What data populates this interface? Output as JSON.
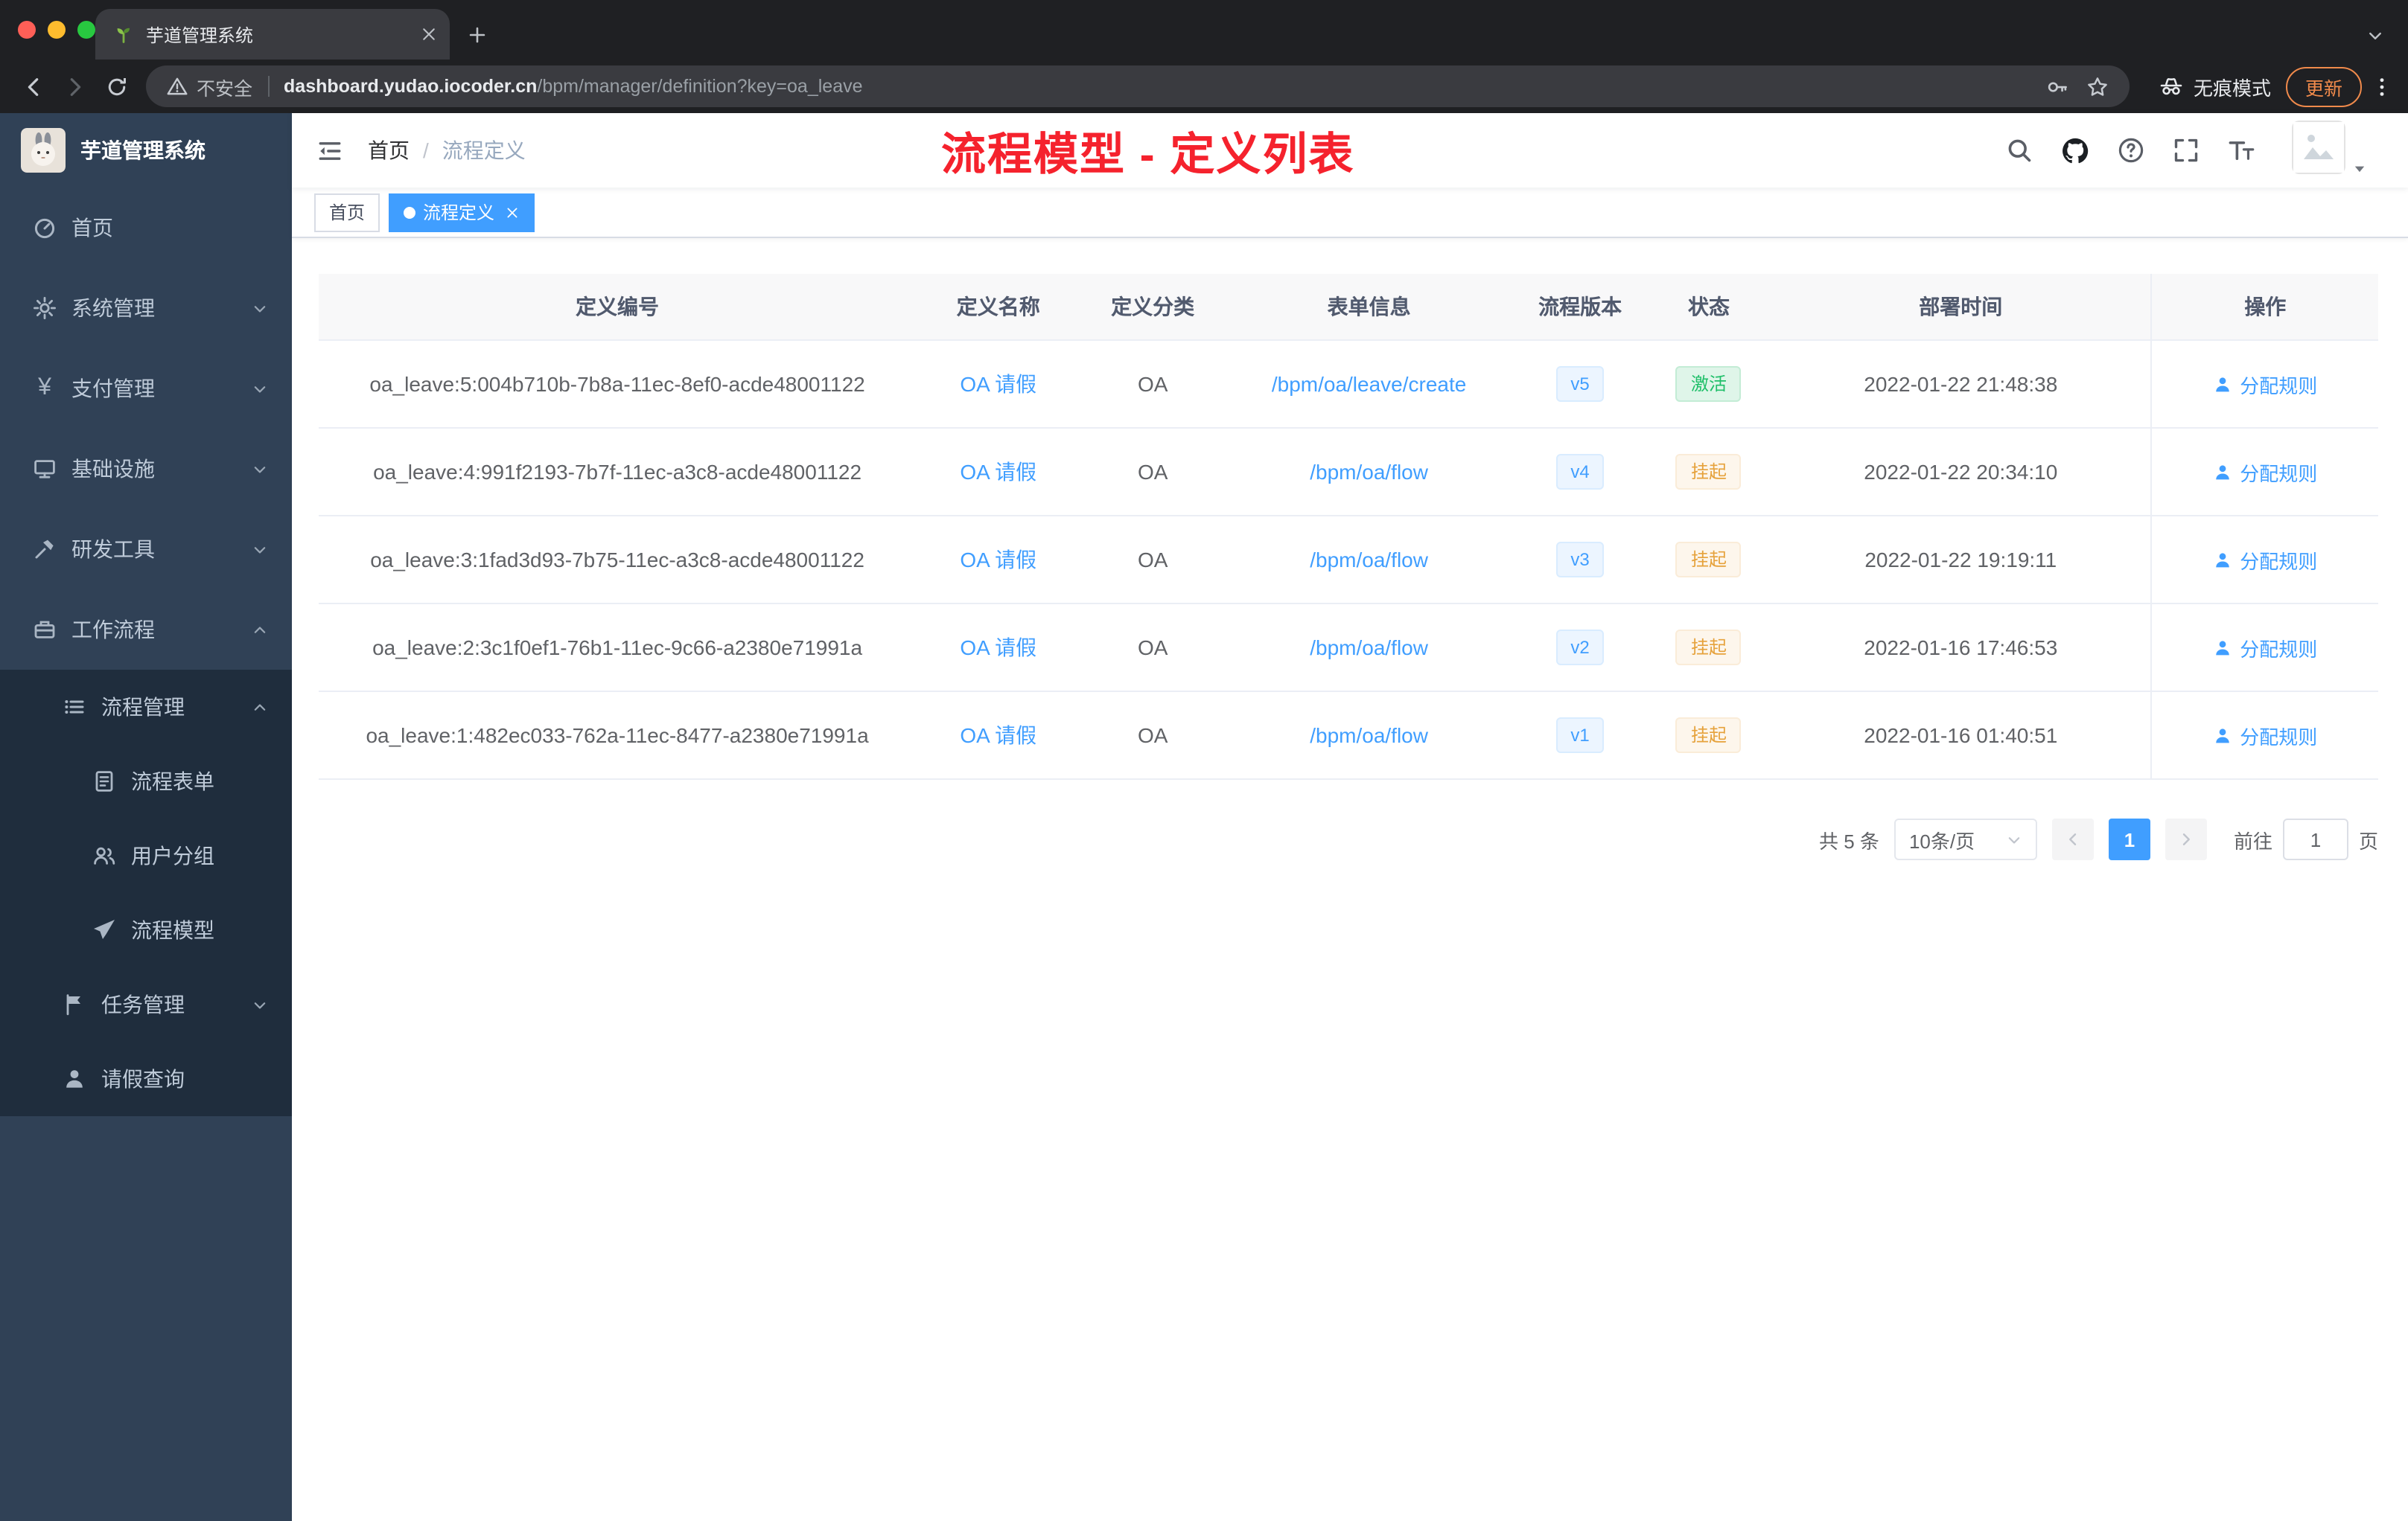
{
  "browser": {
    "tab": {
      "title": "芋道管理系统",
      "favicon": "sprout-icon"
    },
    "address": {
      "security_label": "不安全",
      "url_domain": "dashboard.yudao.iocoder.cn",
      "url_path": "/bpm/manager/definition?key=oa_leave"
    },
    "incognito_label": "无痕模式",
    "update_label": "更新"
  },
  "sidebar": {
    "logo_title": "芋道管理系统",
    "items": [
      {
        "label": "首页",
        "icon": "dashboard-icon",
        "level": 1,
        "chevron": ""
      },
      {
        "label": "系统管理",
        "icon": "gear-icon",
        "level": 1,
        "chevron": "down"
      },
      {
        "label": "支付管理",
        "icon": "yen-icon",
        "level": 1,
        "chevron": "down"
      },
      {
        "label": "基础设施",
        "icon": "monitor-icon",
        "level": 1,
        "chevron": "down"
      },
      {
        "label": "研发工具",
        "icon": "tools-icon",
        "level": 1,
        "chevron": "down"
      },
      {
        "label": "工作流程",
        "icon": "briefcase-icon",
        "level": 1,
        "chevron": "up"
      },
      {
        "label": "流程管理",
        "icon": "list-icon",
        "level": 2,
        "chevron": "up"
      },
      {
        "label": "流程表单",
        "icon": "form-icon",
        "level": 3,
        "chevron": ""
      },
      {
        "label": "用户分组",
        "icon": "users-icon",
        "level": 3,
        "chevron": ""
      },
      {
        "label": "流程模型",
        "icon": "send-icon",
        "level": 3,
        "chevron": ""
      },
      {
        "label": "任务管理",
        "icon": "flag-icon",
        "level": 2,
        "chevron": "down"
      },
      {
        "label": "请假查询",
        "icon": "user-icon",
        "level": 2,
        "chevron": ""
      }
    ]
  },
  "navbar": {
    "breadcrumb": [
      "首页",
      "流程定义"
    ],
    "breadcrumb_separator": "/",
    "annotation": "流程模型 - 定义列表"
  },
  "tags": [
    {
      "label": "首页",
      "active": false,
      "closable": false
    },
    {
      "label": "流程定义",
      "active": true,
      "closable": true
    }
  ],
  "table": {
    "columns": [
      "定义编号",
      "定义名称",
      "定义分类",
      "表单信息",
      "流程版本",
      "状态",
      "部署时间",
      "操作"
    ],
    "rows": [
      {
        "id": "oa_leave:5:004b710b-7b8a-11ec-8ef0-acde48001122",
        "name": "OA 请假",
        "category": "OA",
        "form": "/bpm/oa/leave/create",
        "version": "v5",
        "status": "激活",
        "status_type": "success",
        "deploy_time": "2022-01-22 21:48:38",
        "action": "分配规则"
      },
      {
        "id": "oa_leave:4:991f2193-7b7f-11ec-a3c8-acde48001122",
        "name": "OA 请假",
        "category": "OA",
        "form": "/bpm/oa/flow",
        "version": "v4",
        "status": "挂起",
        "status_type": "warning",
        "deploy_time": "2022-01-22 20:34:10",
        "action": "分配规则"
      },
      {
        "id": "oa_leave:3:1fad3d93-7b75-11ec-a3c8-acde48001122",
        "name": "OA 请假",
        "category": "OA",
        "form": "/bpm/oa/flow",
        "version": "v3",
        "status": "挂起",
        "status_type": "warning",
        "deploy_time": "2022-01-22 19:19:11",
        "action": "分配规则"
      },
      {
        "id": "oa_leave:2:3c1f0ef1-76b1-11ec-9c66-a2380e71991a",
        "name": "OA 请假",
        "category": "OA",
        "form": "/bpm/oa/flow",
        "version": "v2",
        "status": "挂起",
        "status_type": "warning",
        "deploy_time": "2022-01-16 17:46:53",
        "action": "分配规则"
      },
      {
        "id": "oa_leave:1:482ec033-762a-11ec-8477-a2380e71991a",
        "name": "OA 请假",
        "category": "OA",
        "form": "/bpm/oa/flow",
        "version": "v1",
        "status": "挂起",
        "status_type": "warning",
        "deploy_time": "2022-01-16 01:40:51",
        "action": "分配规则"
      }
    ]
  },
  "pagination": {
    "total": "共 5 条",
    "page_size": "10条/页",
    "pages": [
      "1"
    ],
    "current_page": "1",
    "goto_label": "前往",
    "goto_value": "1",
    "page_unit": "页"
  },
  "colors": {
    "accent": "#409eff",
    "annotation_red": "#f5222d",
    "sidebar_bg": "#304156",
    "submenu_bg": "#1f2d3d",
    "status_active_green": "#1fbf69",
    "status_suspended_orange": "#e6a23c"
  }
}
